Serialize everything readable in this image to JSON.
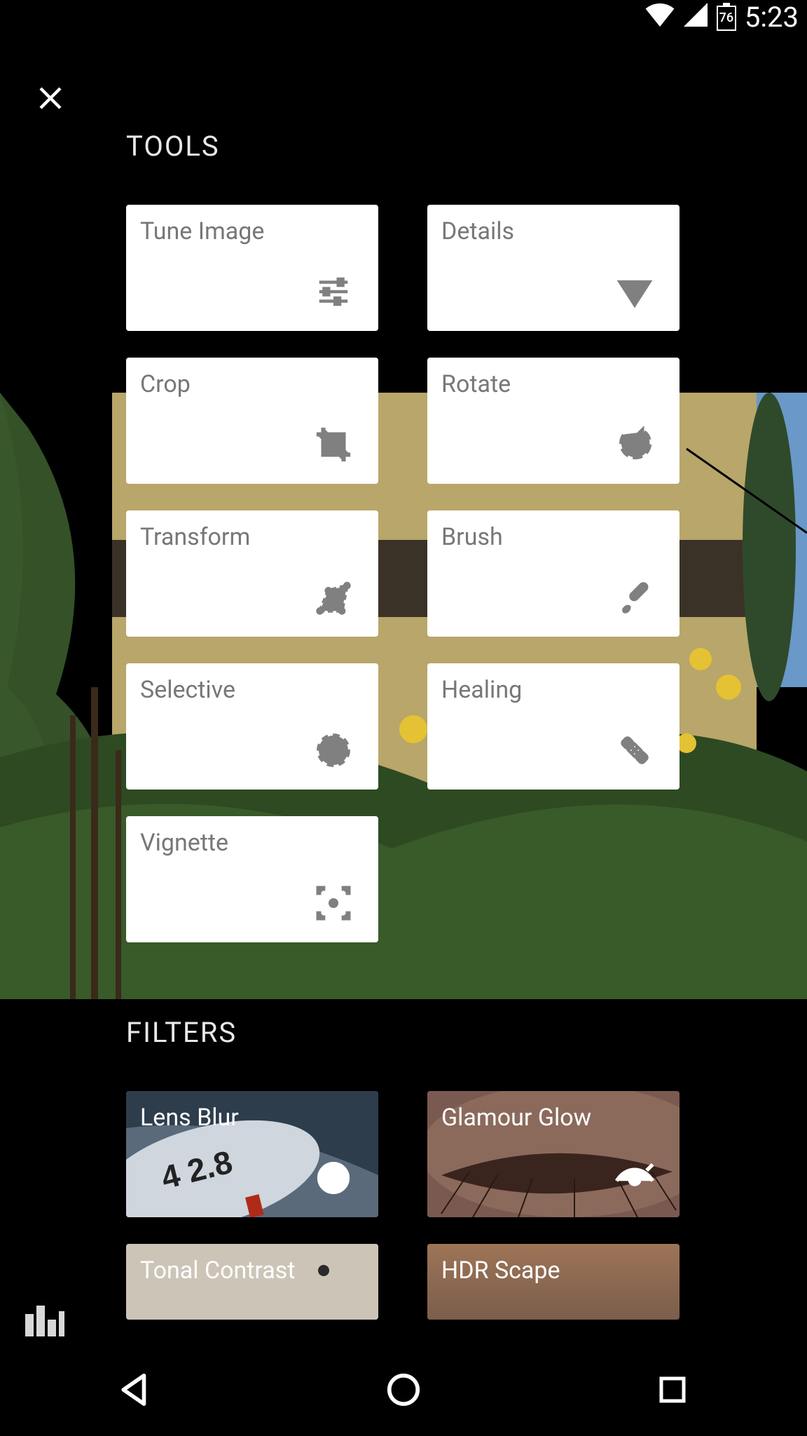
{
  "status": {
    "battery_pct": "76",
    "time": "5:23"
  },
  "sections": {
    "tools_title": "TOOLS",
    "filters_title": "FILTERS"
  },
  "tools": [
    {
      "label": "Tune Image",
      "icon": "sliders"
    },
    {
      "label": "Details",
      "icon": "triangle"
    },
    {
      "label": "Crop",
      "icon": "crop"
    },
    {
      "label": "Rotate",
      "icon": "rotate"
    },
    {
      "label": "Transform",
      "icon": "transform"
    },
    {
      "label": "Brush",
      "icon": "brush"
    },
    {
      "label": "Selective",
      "icon": "selective"
    },
    {
      "label": "Healing",
      "icon": "healing"
    },
    {
      "label": "Vignette",
      "icon": "vignette"
    }
  ],
  "filters": [
    {
      "label": "Lens Blur",
      "icon": "target",
      "class": "lensblur"
    },
    {
      "label": "Glamour Glow",
      "icon": "eye",
      "class": "glamour"
    },
    {
      "label": "Tonal Contrast",
      "icon": "",
      "class": "tonal"
    },
    {
      "label": "HDR Scape",
      "icon": "",
      "class": "hdr"
    }
  ]
}
